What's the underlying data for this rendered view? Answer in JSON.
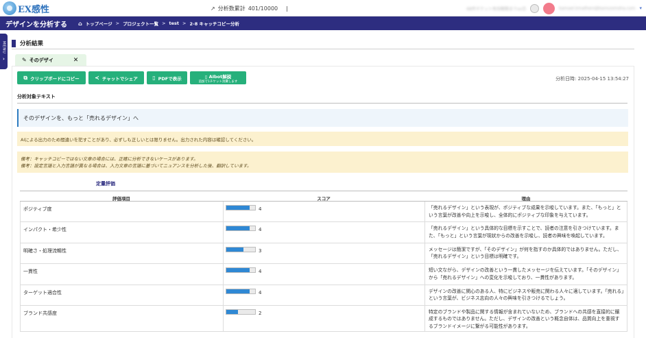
{
  "header": {
    "logo_text": "EX感性",
    "counter_label": "分析数累計",
    "counter_value": "401/10000",
    "counter_sep": "|",
    "ticket_text": "68件チケット有効期限までxx日",
    "user_email": "kamael.kmatheni@kamuiomsha.com",
    "dropdown_glyph": "▾"
  },
  "nav": {
    "title": "デザインを分析する",
    "breadcrumb": [
      "トップページ",
      "プロジェクト一覧",
      "test",
      "2-8 キャッチコピー分析"
    ],
    "sep": ">"
  },
  "menu_tab": {
    "label": "MENU",
    "chevron": "›"
  },
  "section": {
    "title": "分析結果"
  },
  "card_tab": {
    "label": "そのデザイ",
    "close_glyph": "✕"
  },
  "actions": {
    "copy": "クリップボードにコピー",
    "share": "チャットでシェア",
    "pdf": "PDFで表示",
    "ai_title": "AIbot解説",
    "ai_sub": "追加で1チケット消費します"
  },
  "timestamp": "分析日時: 2025-04-15 13:54:27",
  "target": {
    "label": "分析対象テキスト",
    "text": "そのデザインを、もっと「売れるデザイン」へ"
  },
  "warnings": {
    "disclaimer": "AIによる出力のため間違いを犯すことがあり、必ずしも正しいとは限りません。出力された内容は確認してください。",
    "note1": "備考：キャッチコピーではない文章の場合には、正確に分析できないケースがあります。",
    "note2": "備考：設定言語と入力言語が異なる場合は、入力文章の言語に基づいてニュアンスを分析した後、翻訳しています。"
  },
  "quant": {
    "title": "定量評価",
    "headers": {
      "item": "評価項目",
      "score": "スコア",
      "reason": "理由"
    },
    "max_score": 5,
    "rows": [
      {
        "item": "ポジティブ度",
        "score": 4,
        "reason": "「売れるデザイン」という表現が、ポジティブな成果を示唆しています。また、「もっと」という言葉が改善や向上を示唆し、全体的にポジティブな印象を与えています。"
      },
      {
        "item": "インパクト・希少性",
        "score": 4,
        "reason": "「売れるデザイン」という具体的な目標を示すことで、読者の注意を引きつけています。また、「もっと」という言葉が現状からの改善を示唆し、読者の興味を喚起しています。"
      },
      {
        "item": "明確さ・処理流暢性",
        "score": 3,
        "reason": "メッセージは簡潔ですが、「そのデザイン」が何を指すのか具体的ではありません。ただし、「売れるデザイン」という目標は明確です。"
      },
      {
        "item": "一貫性",
        "score": 4,
        "reason": "短い文ながら、デザインの改善という一貫したメッセージを伝えています。「そのデザイン」から「売れるデザイン」への変化を示唆しており、一貫性があります。"
      },
      {
        "item": "ターゲット適合性",
        "score": 4,
        "reason": "デザインの改善に関心のある人、特にビジネスや販売に関わる人々に適しています。「売れる」という言葉が、ビジネス志向の人々の興味を引きつけるでしょう。"
      },
      {
        "item": "ブランド共感度",
        "score": 2,
        "reason": "特定のブランドや製品に関する情報が含まれていないため、ブランドへの共感を直接的に醸成するものではありません。ただし、デザインの改善という概念自体は、品質向上を重視するブランドイメージに繋がる可能性があります。"
      }
    ]
  },
  "colors": {
    "navy": "#2d2d80",
    "green": "#26b07b",
    "bar": "#2f88d4",
    "warn_bg": "#fcf1cf"
  }
}
